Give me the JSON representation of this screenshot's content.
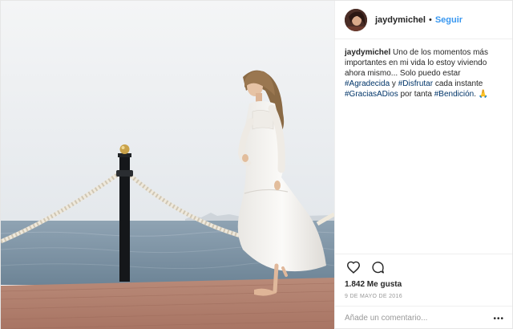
{
  "post": {
    "username": "jaydymichel",
    "separator": "•",
    "follow_label": "Seguir",
    "caption": {
      "username": "jaydymichel",
      "text_1": " Uno de los momentos más importantes en mi vida lo estoy viviendo ahora mismo... Solo puedo estar ",
      "tag_1": "#Agradecida",
      "text_2": " y ",
      "tag_2": "#Disfrutar",
      "text_3": " cada instante ",
      "tag_3": "#GraciasADios",
      "text_4": " por tanta ",
      "tag_4": "#Bendición",
      "text_5": ". ",
      "emoji": "🙏"
    },
    "likes": "1.842 Me gusta",
    "date": "9 de mayo de 2016",
    "comment_placeholder": "Añade un comentario...",
    "more_label": "•••"
  },
  "colors": {
    "link": "#3897f0",
    "hashtag": "#003569",
    "meta": "#999999",
    "text": "#262626"
  },
  "icons": [
    "heart-icon",
    "comment-icon",
    "more-options-icon"
  ]
}
